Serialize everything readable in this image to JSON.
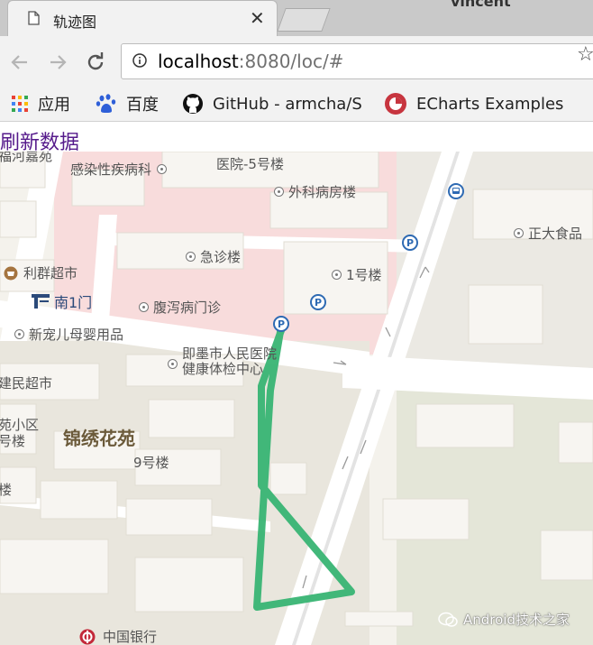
{
  "browser": {
    "tab_title": "轨迹图",
    "tab_close": "✕",
    "profile_name": "vincent",
    "url_host": "localhost",
    "url_rest": ":8080/loc/#",
    "star_glyph": "☆",
    "bookmarks": [
      "应用",
      "百度",
      "GitHub - armcha/S",
      "ECharts Examples"
    ]
  },
  "page": {
    "refresh_link": "刷新数据"
  },
  "map": {
    "colors": {
      "hospital": "#f8dcdc",
      "road": "#ffffff",
      "block": "#e9e6dd",
      "building": "#f7f5f1",
      "track": "#38b473",
      "parking": "#2e6ab3"
    },
    "pois": {
      "gannan": "福河嘉苑",
      "infect": "感染性疾病科",
      "hosp5": "医院-5号楼",
      "surgery": "外科病房楼",
      "zhengda": "正大食品",
      "emergency": "急诊楼",
      "lijun": "利群超市",
      "bldg1": "1号楼",
      "south_gate": "南1门",
      "diarrhea": "腹泻病门诊",
      "xinchong": "新宠儿母婴用品",
      "jimo_l1": "即墨市人民医院",
      "jimo_l2": "健康体检中心",
      "jianmin": "建民超市",
      "jinxiu": "锦绣花苑",
      "xiaoqu": "苑小区",
      "haolou": "号楼",
      "bldg9": "9号楼",
      "lou": "楼",
      "boc": "中国银行"
    },
    "icons": [
      "parking-icon",
      "bus-stop-icon",
      "shop-icon",
      "gate-icon",
      "bank-icon"
    ],
    "watermark": "Android技术之家"
  }
}
